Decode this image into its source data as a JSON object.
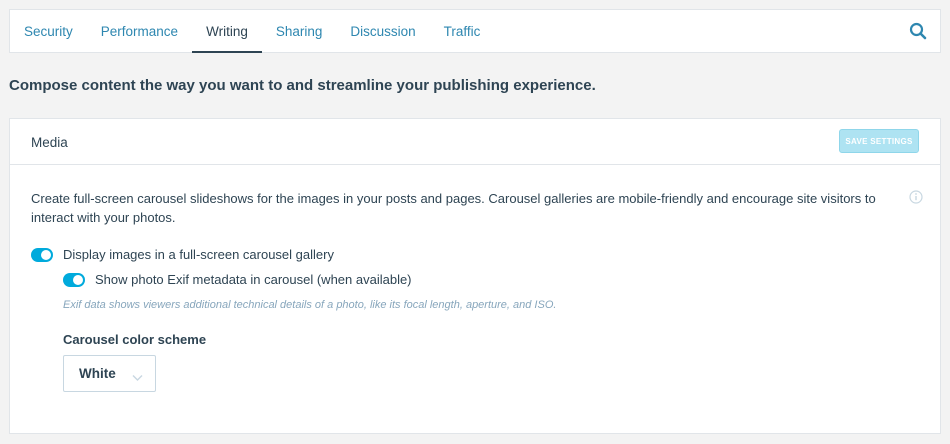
{
  "tabs": [
    {
      "label": "Security",
      "active": false
    },
    {
      "label": "Performance",
      "active": false
    },
    {
      "label": "Writing",
      "active": true
    },
    {
      "label": "Sharing",
      "active": false
    },
    {
      "label": "Discussion",
      "active": false
    },
    {
      "label": "Traffic",
      "active": false
    }
  ],
  "headline": "Compose content the way you want to and streamline your publishing experience.",
  "card": {
    "title": "Media",
    "save_label": "SAVE SETTINGS",
    "description": "Create full-screen carousel slideshows for the images in your posts and pages. Carousel galleries are mobile-friendly and encourage site visitors to interact with your photos.",
    "toggle_carousel_label": "Display images in a full-screen carousel gallery",
    "toggle_carousel_on": true,
    "toggle_exif_label": "Show photo Exif metadata in carousel (when available)",
    "toggle_exif_on": true,
    "exif_note": "Exif data shows viewers additional technical details of a photo, like its focal length, aperture, and ISO.",
    "color_scheme_label": "Carousel color scheme",
    "color_scheme_value": "White"
  },
  "colors": {
    "accent": "#00aadc",
    "link": "#2e87b0",
    "text": "#2e4453",
    "save_button_disabled": "#aee3f2"
  },
  "icons": {
    "search": "search-icon",
    "info": "info-icon",
    "chevron": "chevron-down-icon"
  }
}
